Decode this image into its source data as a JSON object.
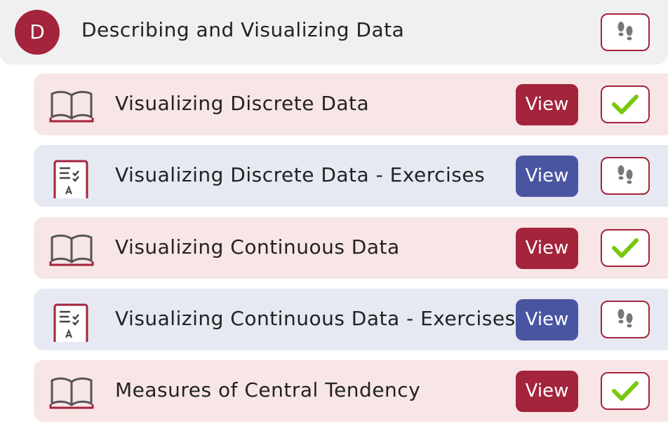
{
  "module": {
    "badge_letter": "D",
    "title": "Describing and Visualizing Data",
    "status_icon": "footprints-icon"
  },
  "colors": {
    "reading_accent": "#a3243b",
    "exercise_accent": "#4a55a2",
    "check_green": "#7ac70c",
    "reading_bg": "#f8e5e6",
    "exercise_bg": "#e6e8f2"
  },
  "items": [
    {
      "type": "reading",
      "icon": "book-icon",
      "title": "Visualizing Discrete Data",
      "button_label": "View",
      "status": "completed",
      "status_icon": "checkmark-icon"
    },
    {
      "type": "exercise",
      "icon": "worksheet-icon",
      "title": "Visualizing Discrete Data - Exercises",
      "button_label": "View",
      "status": "not-started",
      "status_icon": "footprints-icon"
    },
    {
      "type": "reading",
      "icon": "book-icon",
      "title": "Visualizing Continuous Data",
      "button_label": "View",
      "status": "completed",
      "status_icon": "checkmark-icon"
    },
    {
      "type": "exercise",
      "icon": "worksheet-icon",
      "title": "Visualizing Continuous Data - Exercises",
      "button_label": "View",
      "status": "not-started",
      "status_icon": "footprints-icon"
    },
    {
      "type": "reading",
      "icon": "book-icon",
      "title": "Measures of Central Tendency",
      "button_label": "View",
      "status": "completed",
      "status_icon": "checkmark-icon"
    }
  ]
}
